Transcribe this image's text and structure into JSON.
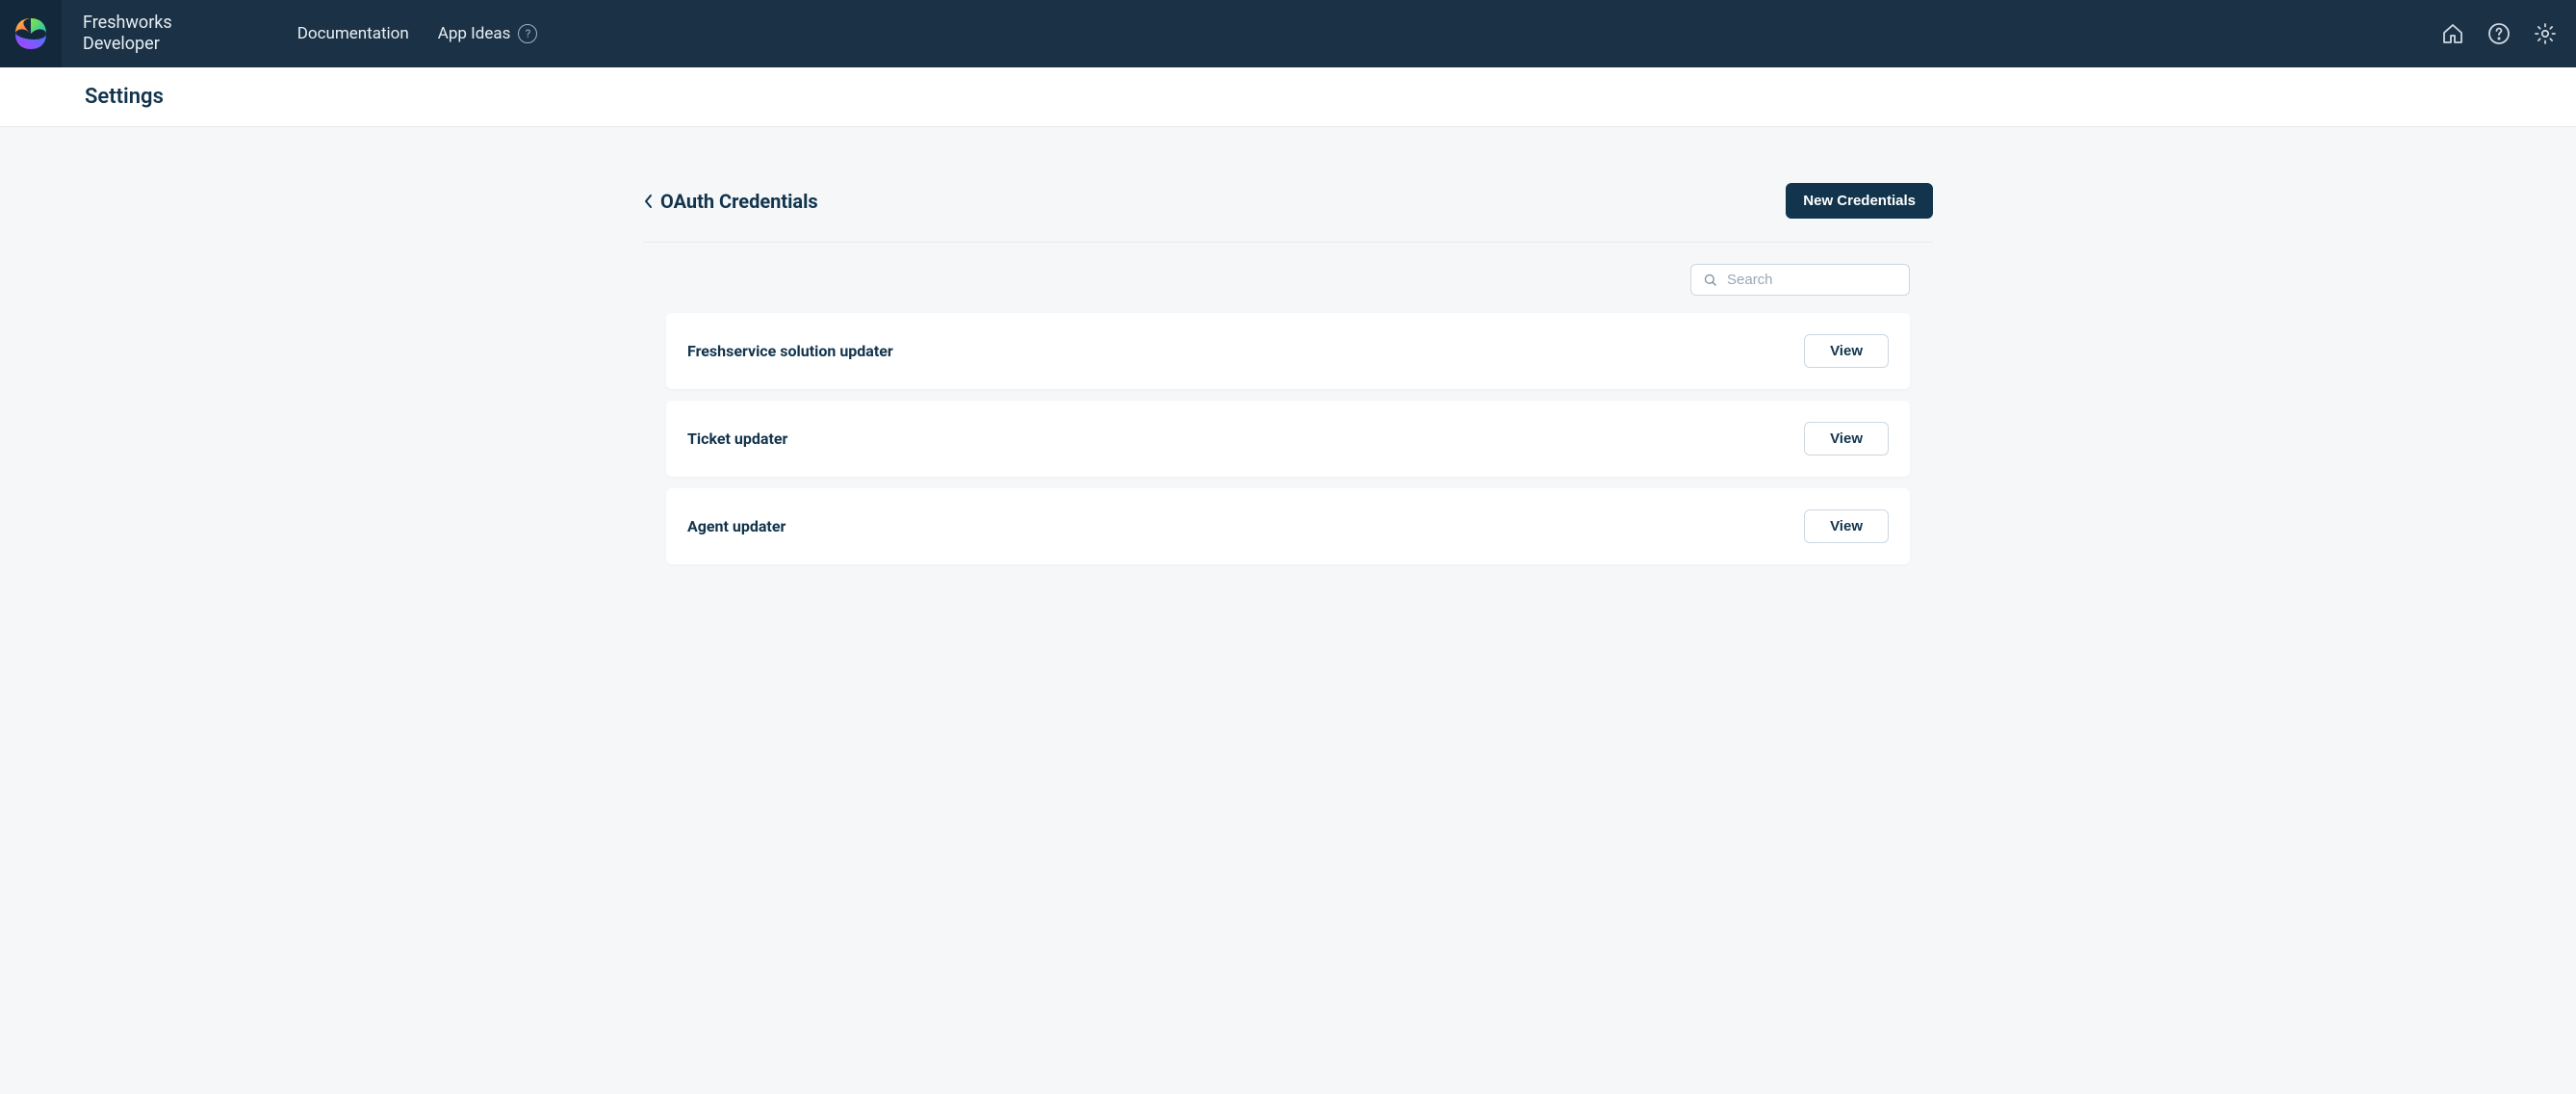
{
  "brand": {
    "line1": "Freshworks",
    "line2": "Developer"
  },
  "nav": {
    "documentation": "Documentation",
    "app_ideas": "App Ideas"
  },
  "page": {
    "header_title": "Settings"
  },
  "section": {
    "title": "OAuth Credentials",
    "new_button": "New Credentials"
  },
  "search": {
    "placeholder": "Search",
    "value": ""
  },
  "credentials": [
    {
      "name": "Freshservice solution updater",
      "view_label": "View"
    },
    {
      "name": "Ticket updater",
      "view_label": "View"
    },
    {
      "name": "Agent updater",
      "view_label": "View"
    }
  ]
}
